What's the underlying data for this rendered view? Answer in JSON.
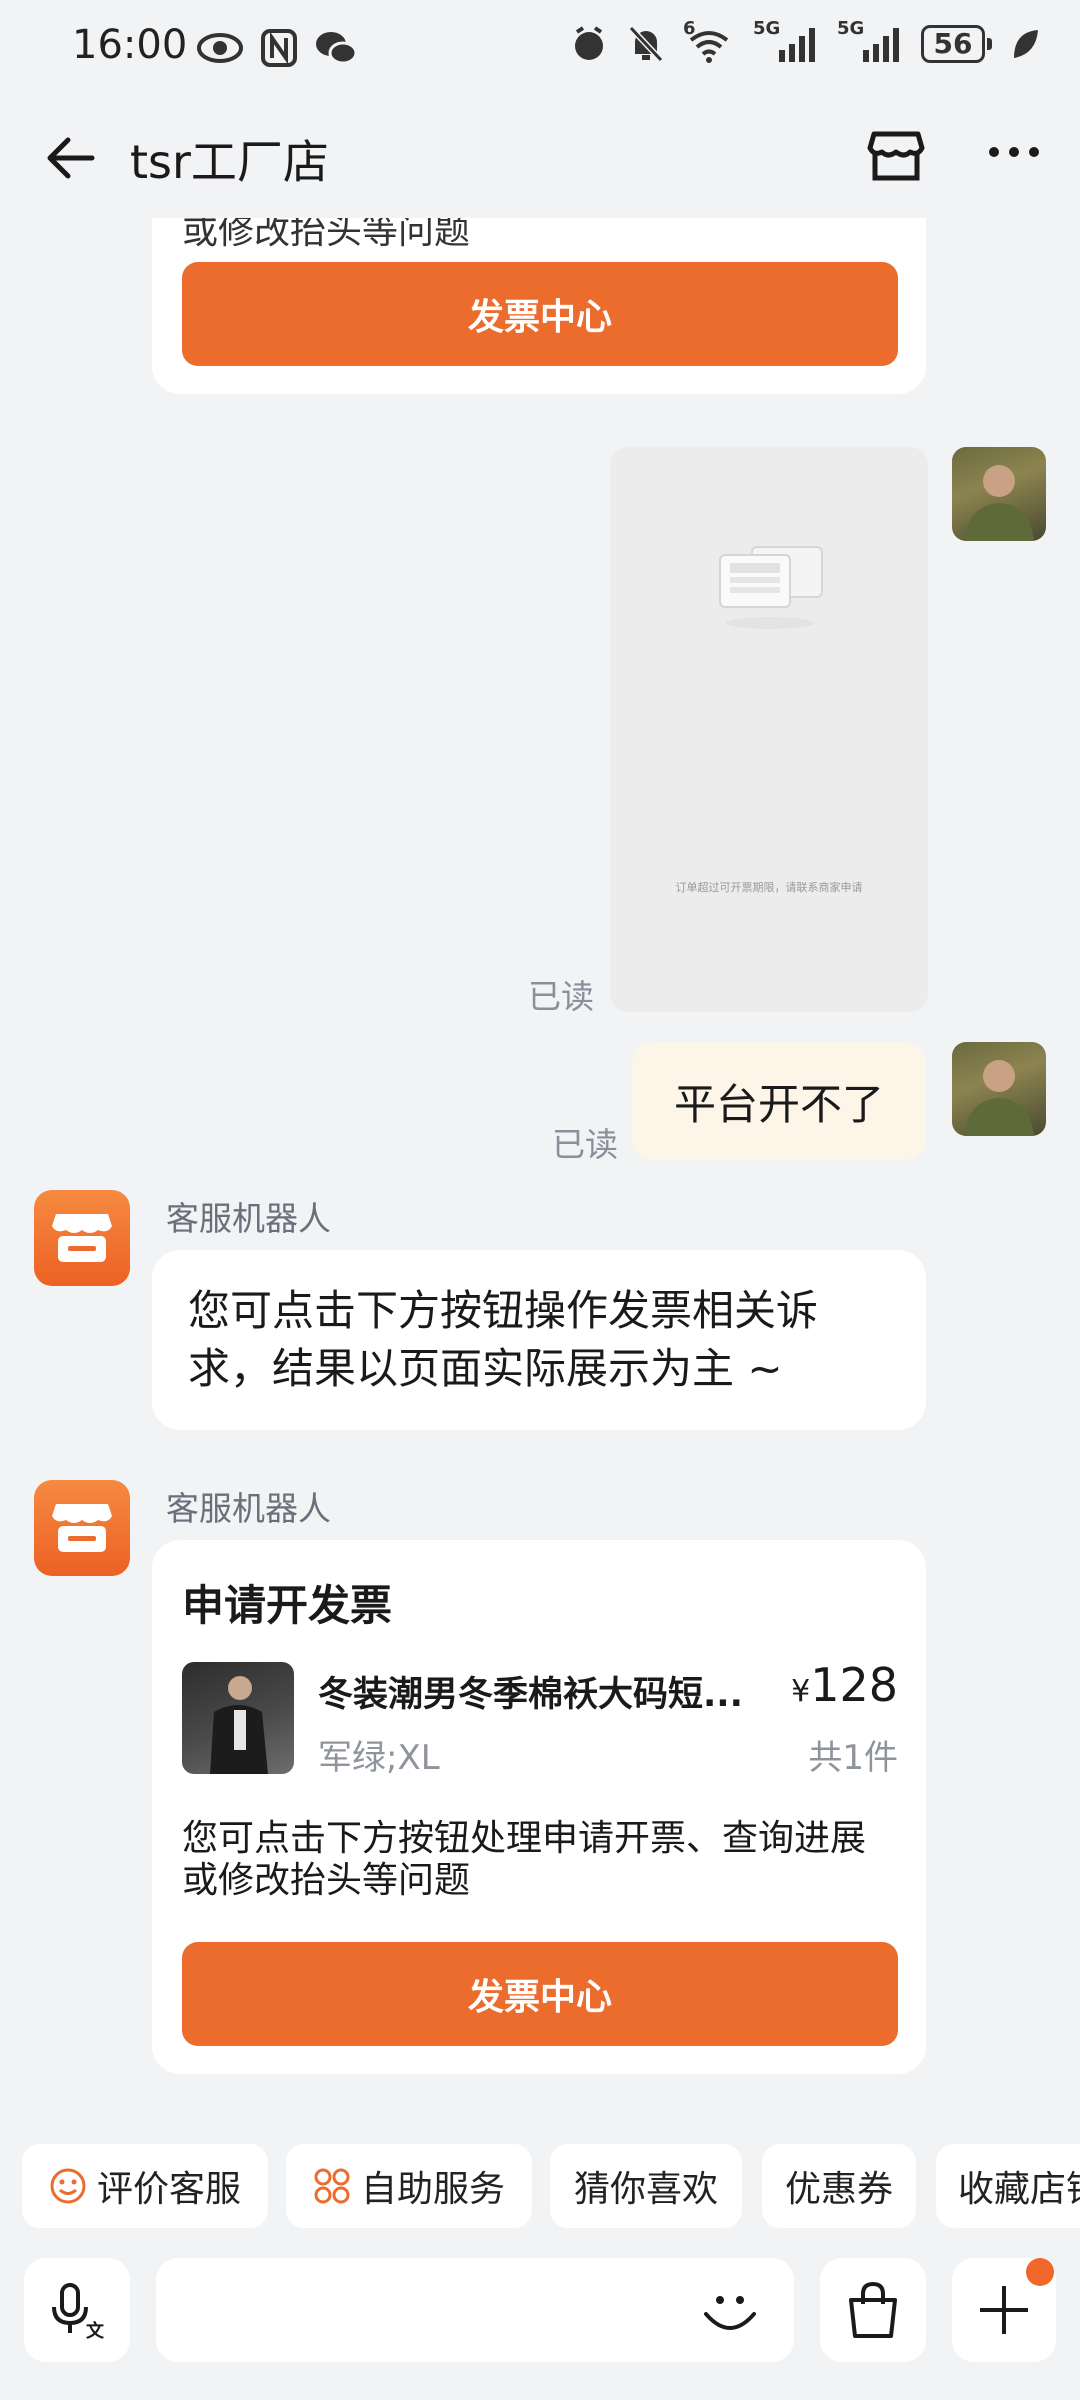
{
  "status_bar": {
    "time": "16:00",
    "battery": "56",
    "signal_label_1": "5G",
    "signal_label_2": "5G",
    "wifi_label": "6"
  },
  "header": {
    "title": "tsr工厂店"
  },
  "messages": {
    "top_card_partial_text": "或修改抬头等问题",
    "top_card_button": "发票中心",
    "image_message": {
      "caption": "订单超过可开票期限，请联系商家申请",
      "read_status": "已读"
    },
    "user_text_message": {
      "text": "平台开不了",
      "read_status": "已读"
    },
    "bot_message_1": {
      "sender": "客服机器人",
      "text": "您可点击下方按钮操作发票相关诉求，结果以页面实际展示为主 ~"
    },
    "bot_message_2": {
      "sender": "客服机器人",
      "card_title": "申请开发票",
      "product_name": "冬装潮男冬季棉袄大码短...",
      "price_symbol": "¥",
      "price": "128",
      "variant": "军绿;XL",
      "quantity": "共1件",
      "description": "您可点击下方按钮处理申请开票、查询进展或修改抬头等问题",
      "button": "发票中心"
    }
  },
  "quick_actions": [
    {
      "label": "评价客服",
      "icon": "smile-icon"
    },
    {
      "label": "自助服务",
      "icon": "grid-icon"
    },
    {
      "label": "猜你喜欢"
    },
    {
      "label": "优惠券"
    },
    {
      "label": "收藏店铺"
    }
  ],
  "input_bar": {
    "voice_icon": "microphone-icon",
    "emoji_icon": "smile-face-icon",
    "bag_icon": "shopping-bag-icon",
    "plus_icon": "plus-icon"
  },
  "colors": {
    "accent": "#ec6c2d",
    "background": "#f2f3f5",
    "user_bubble": "#fdf5e8"
  }
}
